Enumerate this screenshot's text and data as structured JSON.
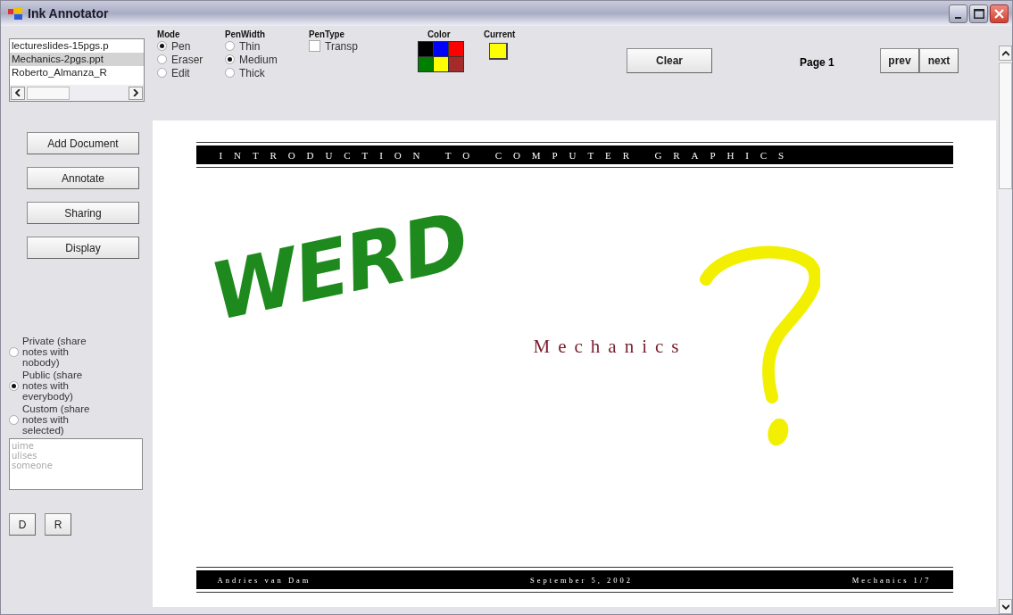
{
  "window": {
    "title": "Ink Annotator"
  },
  "documents": [
    {
      "label": "lectureslides-15pgs.p",
      "selected": false
    },
    {
      "label": "Mechanics-2pgs.ppt",
      "selected": true
    },
    {
      "label": "Roberto_Almanza_R",
      "selected": false
    }
  ],
  "side_buttons": [
    "Add Document",
    "Annotate",
    "Sharing",
    "Display"
  ],
  "sharing": [
    {
      "label": "Private (share notes with nobody)",
      "selected": false
    },
    {
      "label": "Public (share notes with everybody)",
      "selected": true
    },
    {
      "label": "Custom (share notes with selected)",
      "selected": false
    }
  ],
  "users": {
    "disabled": true,
    "items": [
      "uime",
      "ulises",
      "someone"
    ]
  },
  "bottom_buttons": [
    "D",
    "R"
  ],
  "mode": {
    "label": "Mode",
    "options": [
      {
        "label": "Pen",
        "selected": true
      },
      {
        "label": "Eraser",
        "selected": false
      },
      {
        "label": "Edit",
        "selected": false
      }
    ]
  },
  "pen_width": {
    "label": "PenWidth",
    "options": [
      {
        "label": "Thin",
        "selected": false
      },
      {
        "label": "Medium",
        "selected": true
      },
      {
        "label": "Thick",
        "selected": false
      }
    ]
  },
  "pen_type": {
    "label": "PenType",
    "option": {
      "label": "Transp",
      "checked": false
    }
  },
  "palette": {
    "label": "Color",
    "swatches": [
      {
        "color": "#000000"
      },
      {
        "color": "#0000ff"
      },
      {
        "color": "#ff0000"
      },
      {
        "color": "#008000"
      },
      {
        "color": "#ffff00"
      },
      {
        "color": "#a52a2a"
      }
    ]
  },
  "current": {
    "label": "Current",
    "color": "#ffff00"
  },
  "clear_button": "Clear",
  "page_label": "Page 1",
  "nav_buttons": [
    "prev",
    "next"
  ],
  "slide": {
    "header": "INTRODUCTION TO COMPUTER GRAPHICS",
    "title": "Mechanics",
    "footer": [
      "Andries van Dam",
      "September 5, 2002",
      "Mechanics 1/7"
    ]
  },
  "annotations": [
    {
      "kind": "word",
      "text": "WERD",
      "color": "#1e8a1e"
    },
    {
      "kind": "question_stroke",
      "color": "#f2f000"
    }
  ]
}
